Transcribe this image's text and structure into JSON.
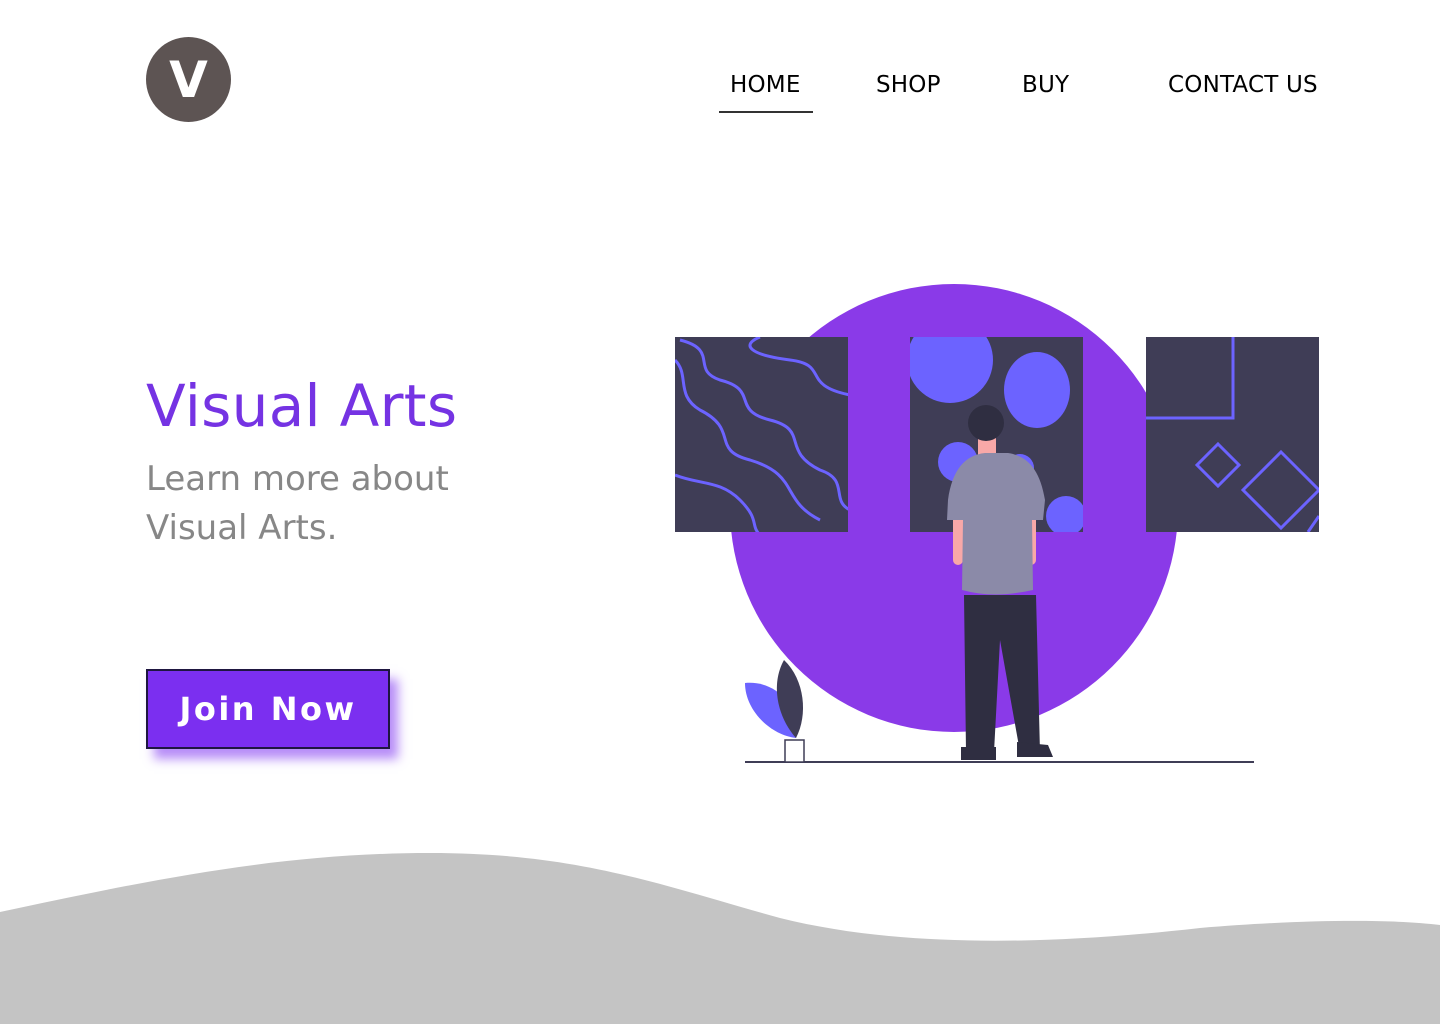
{
  "header": {
    "logo_letter": "V",
    "nav": [
      {
        "label": "HOME",
        "active": true
      },
      {
        "label": "SHOP",
        "active": false
      },
      {
        "label": "BUY",
        "active": false
      },
      {
        "label": "CONTACT US",
        "active": false
      }
    ]
  },
  "hero": {
    "title": "Visual Arts",
    "subtitle": "Learn more about Visual Arts.",
    "cta_label": "Join Now"
  },
  "colors": {
    "accent": "#7533e3",
    "cta": "#7b2ff0",
    "circle": "#8a3ae8",
    "art_dark": "#3f3d56",
    "art_blue": "#6c63ff",
    "wave": "#c4c4c4",
    "logo": "#5d5453"
  },
  "icons": {
    "logo": "logo-v-circle"
  }
}
